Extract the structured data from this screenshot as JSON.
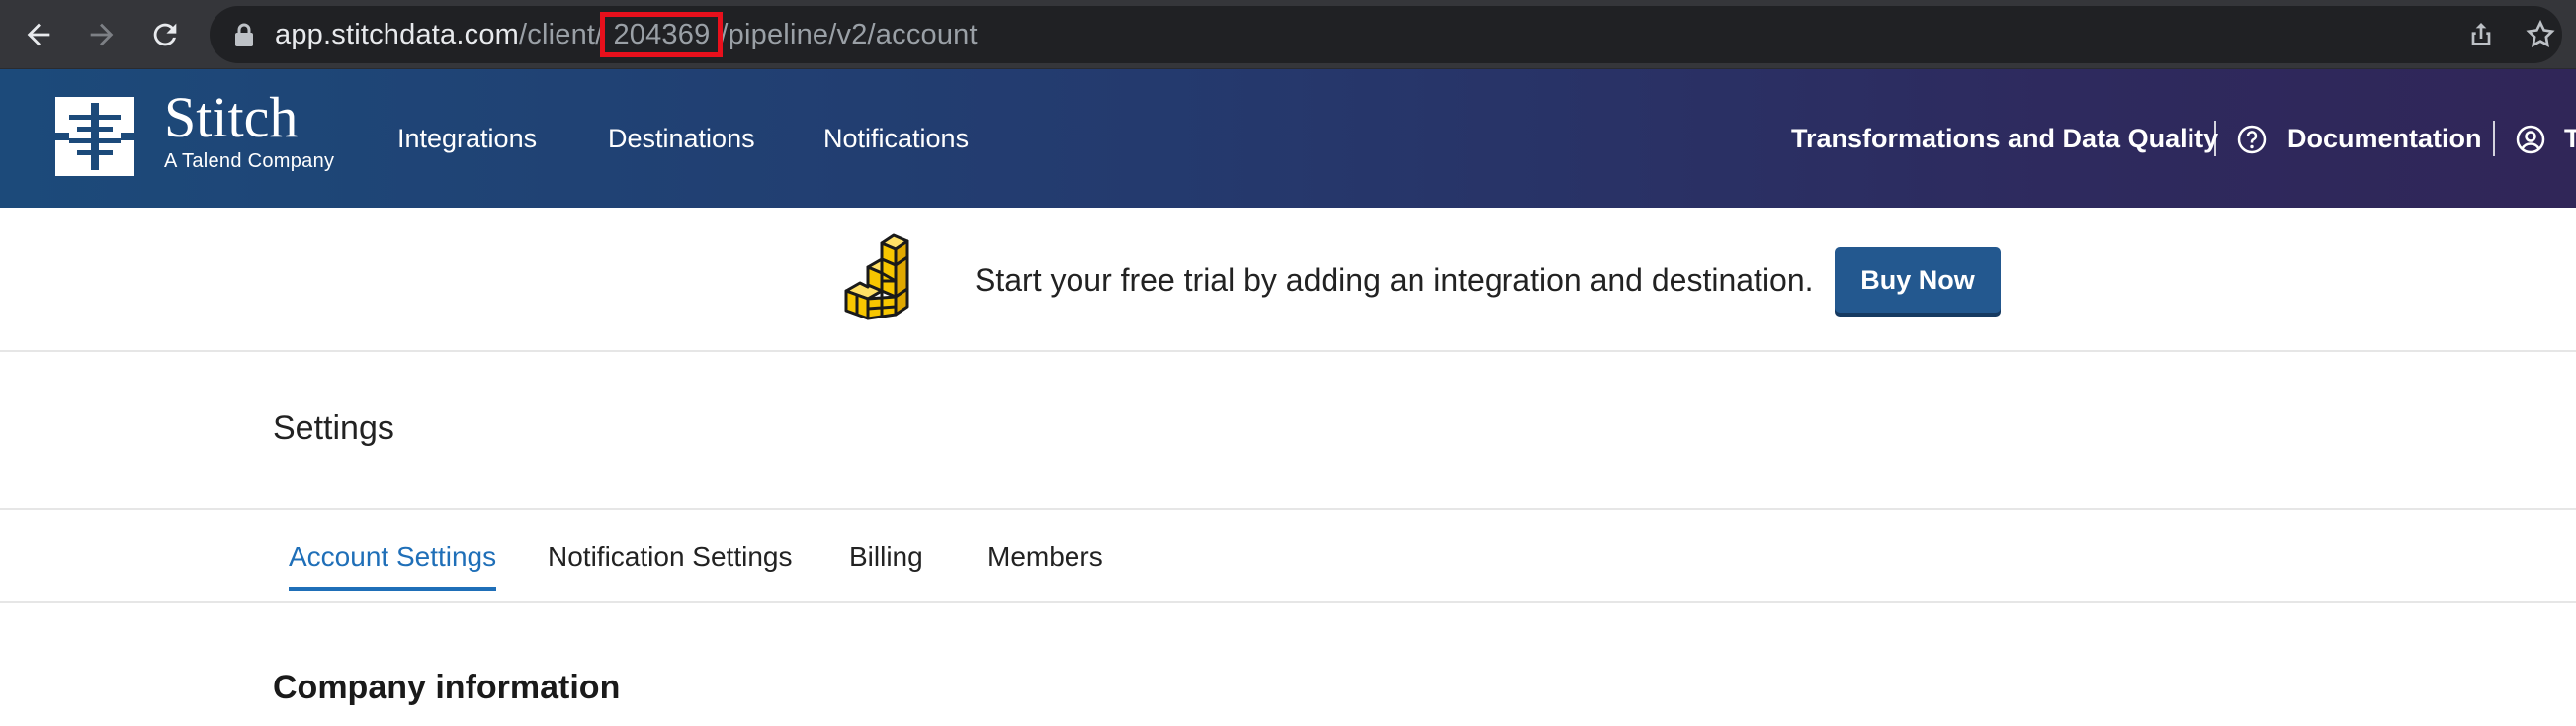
{
  "browser": {
    "url_host": "app.stitchdata.com",
    "url_path_prefix": "/client/",
    "url_client_id": "204369",
    "url_path_suffix": "/pipeline/v2/account"
  },
  "header": {
    "brand_name": "Stitch",
    "brand_tagline": "A Talend Company",
    "nav": {
      "integrations": "Integrations",
      "destinations": "Destinations",
      "notifications": "Notifications"
    },
    "right": {
      "transformations": "Transformations and Data Quality",
      "documentation": "Documentation",
      "user_initial": "T"
    }
  },
  "banner": {
    "message": "Start your free trial by adding an integration and destination.",
    "buy_label": "Buy Now"
  },
  "settings": {
    "title": "Settings",
    "tabs": {
      "account": "Account Settings",
      "notification": "Notification Settings",
      "billing": "Billing",
      "members": "Members"
    },
    "active_tab": "Account Settings",
    "section_title": "Company information"
  },
  "colors": {
    "header_gradient_start": "#1c4a7a",
    "header_gradient_end": "#302658",
    "accent": "#1f6fb8",
    "buy_button": "#23588f",
    "url_highlight": "#e8101c"
  }
}
